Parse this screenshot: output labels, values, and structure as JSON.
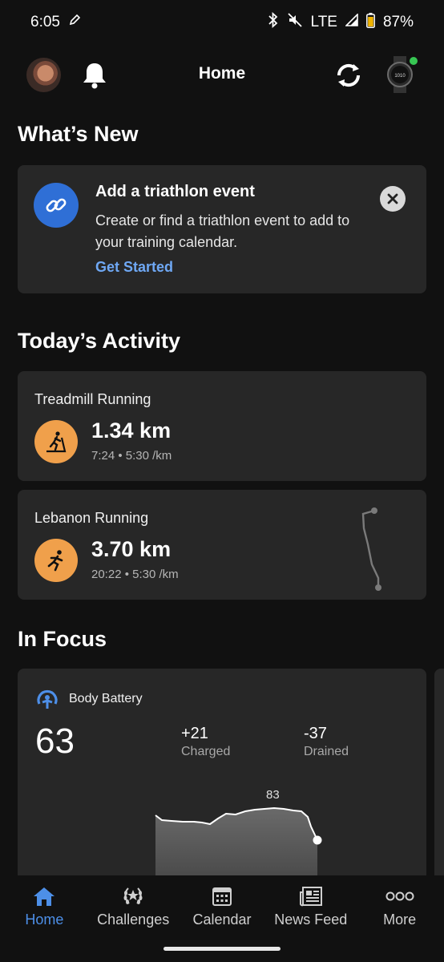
{
  "status_bar": {
    "time": "6:05",
    "network": "LTE",
    "battery": "87%"
  },
  "app_bar": {
    "title": "Home"
  },
  "whats_new": {
    "section_title": "What’s New",
    "card_title": "Add a triathlon event",
    "card_body": "Create or find a triathlon event to add to your training calendar.",
    "link": "Get Started"
  },
  "todays_activity": {
    "section_title": "Today’s Activity",
    "items": [
      {
        "name": "Treadmill Running",
        "distance": "1.34 km",
        "meta": "7:24 • 5:30 /km",
        "icon": "treadmill-icon"
      },
      {
        "name": "Lebanon Running",
        "distance": "3.70 km",
        "meta": "20:22 • 5:30 /km",
        "icon": "running-icon"
      }
    ]
  },
  "in_focus": {
    "section_title": "In Focus",
    "body_battery": {
      "title": "Body Battery",
      "value": "63",
      "charged_value": "+21",
      "charged_label": "Charged",
      "drained_value": "-37",
      "drained_label": "Drained",
      "peak_label": "83"
    }
  },
  "bottom_nav": {
    "items": [
      {
        "label": "Home",
        "icon": "home-icon",
        "active": true
      },
      {
        "label": "Challenges",
        "icon": "laurel-icon",
        "active": false
      },
      {
        "label": "Calendar",
        "icon": "calendar-icon",
        "active": false
      },
      {
        "label": "News Feed",
        "icon": "newspaper-icon",
        "active": false
      },
      {
        "label": "More",
        "icon": "more-dots-icon",
        "active": false
      }
    ]
  },
  "colors": {
    "background": "#111111",
    "card": "#272727",
    "accent_blue": "#4d8fe8",
    "activity_orange": "#f0a04b",
    "online_green": "#37c653"
  }
}
